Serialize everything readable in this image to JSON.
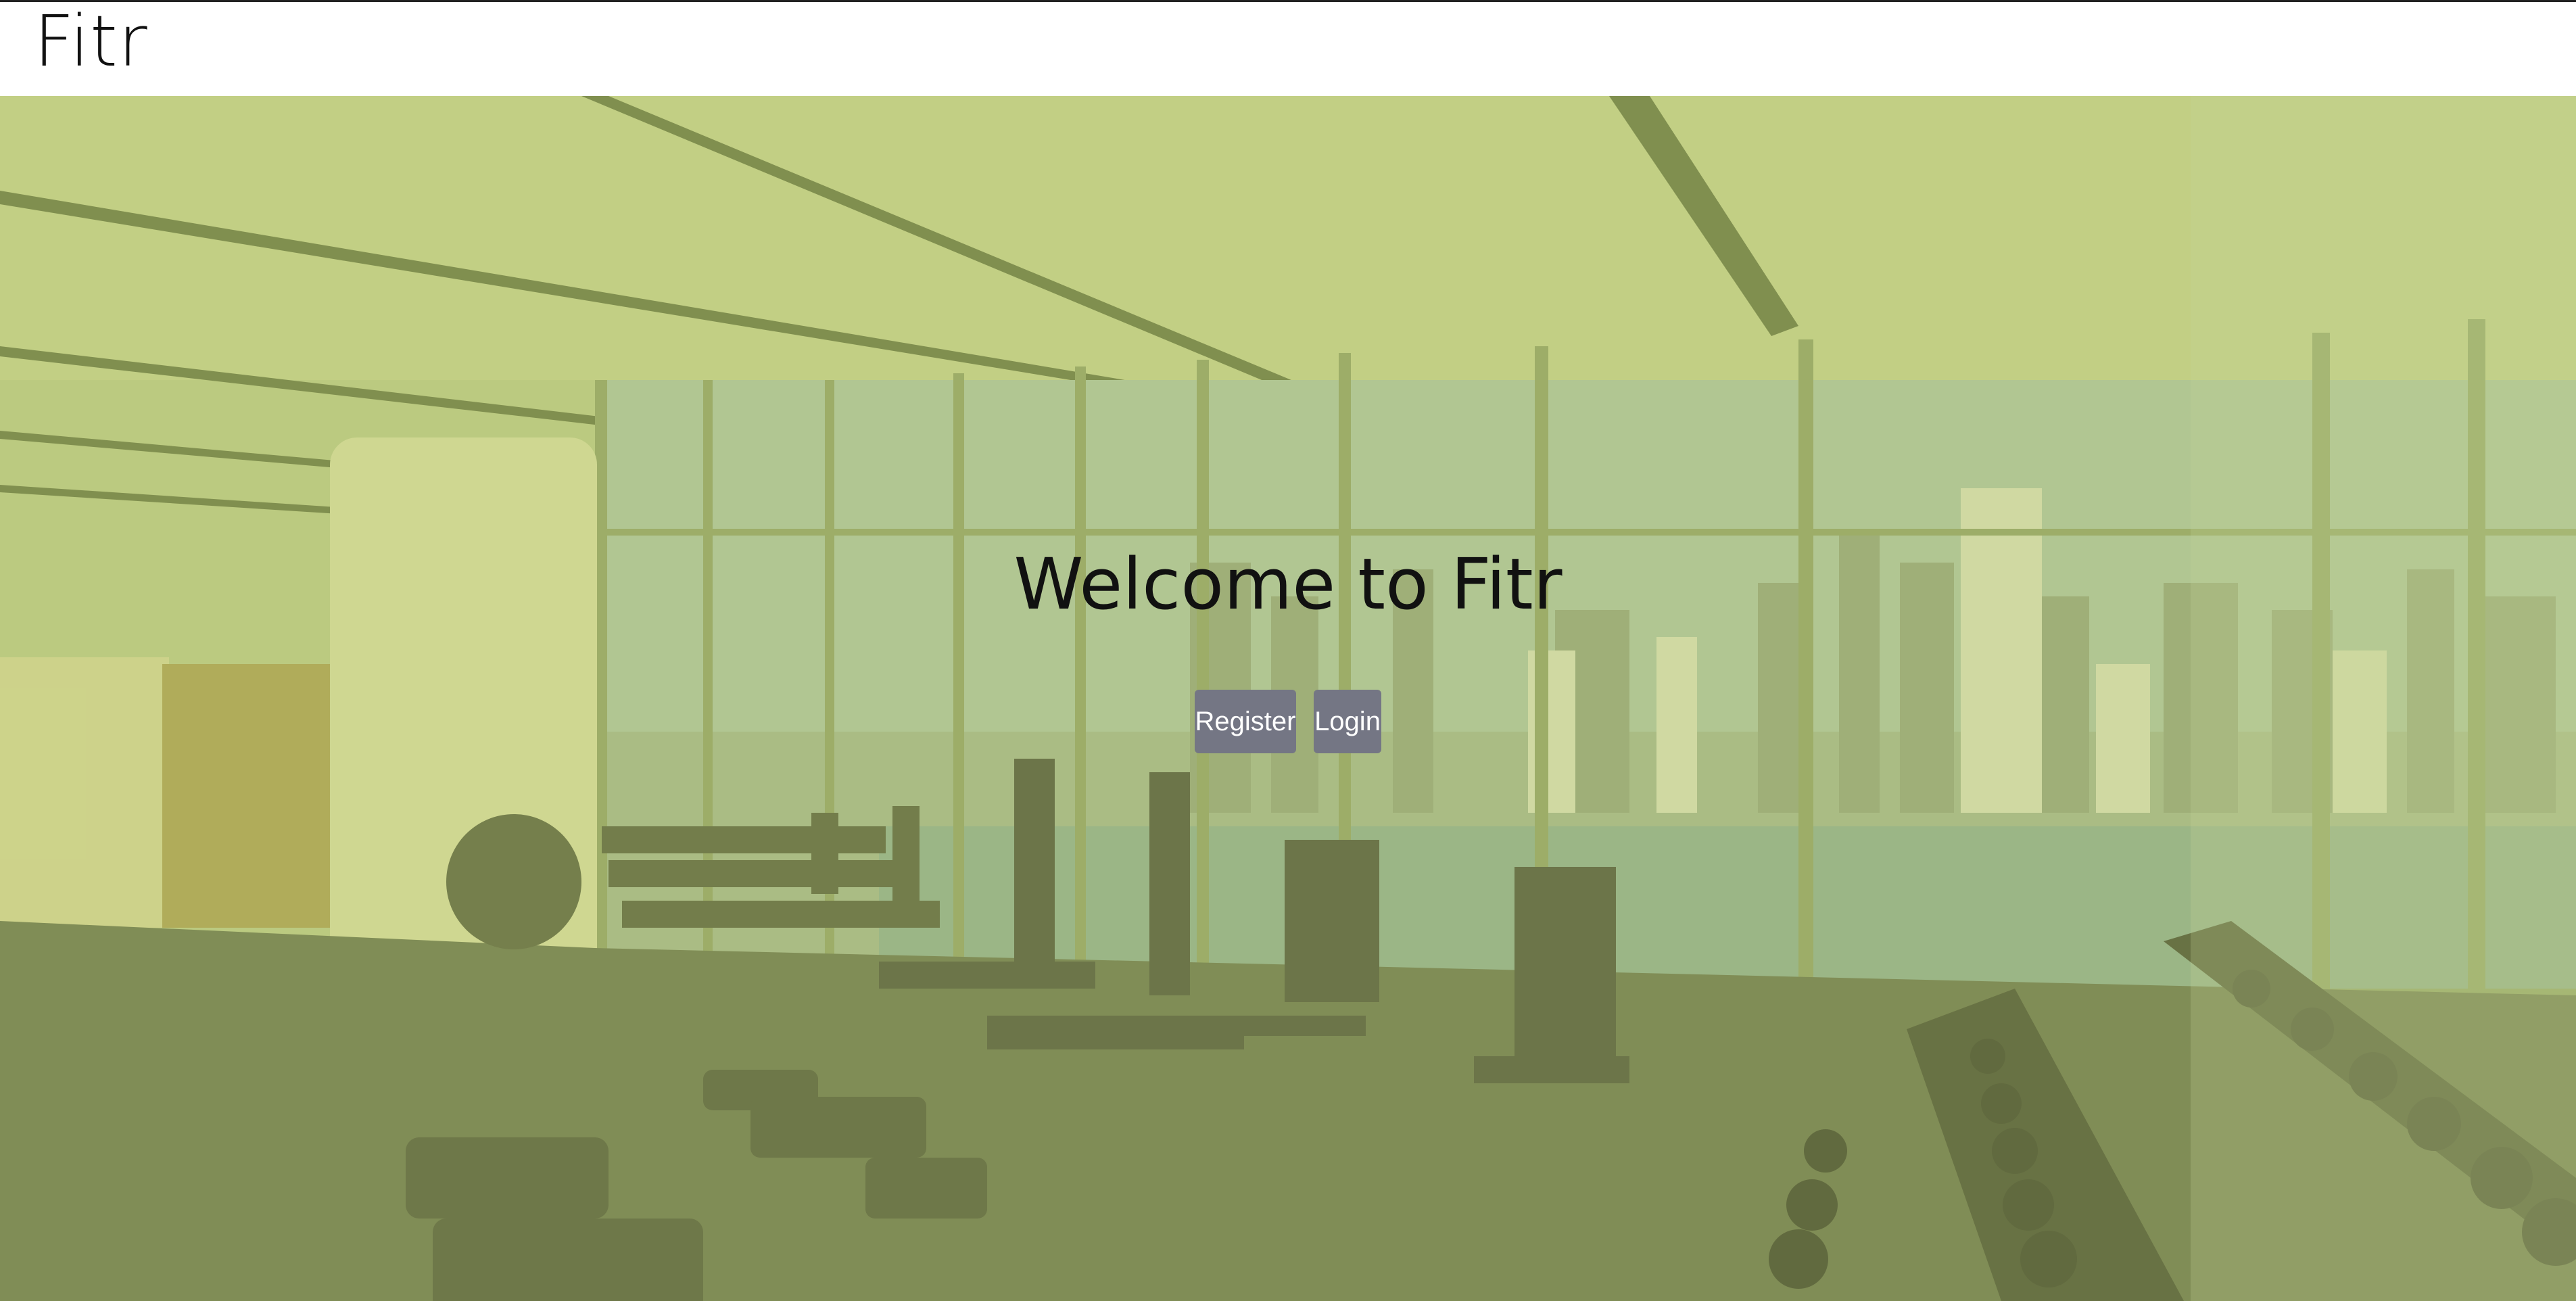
{
  "header": {
    "brand": "Fitr"
  },
  "hero": {
    "headline": "Welcome to Fitr",
    "background_description": "gym interior with treadmills, bikes, benches, dumbbell racks and city skyline through windows",
    "tint_color": "#bfce78"
  },
  "actions": {
    "register_label": "Register",
    "login_label": "Login"
  },
  "colors": {
    "button_bg": "#747684",
    "button_text": "#ffffff",
    "header_bg": "#ffffff"
  }
}
